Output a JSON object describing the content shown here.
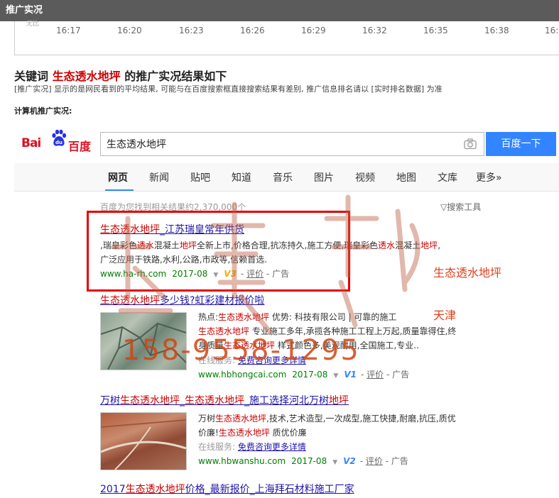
{
  "header": {
    "title": "推广实况"
  },
  "timeline": {
    "tiny_label": "无比",
    "ticks": [
      "16:17",
      "16:20",
      "16:23",
      "16:26",
      "16:29",
      "16:32",
      "16:35",
      "16:38",
      "16:4"
    ]
  },
  "summary": {
    "prefix": "关键词",
    "keyword": "生态透水地坪",
    "suffix": "的推广实况结果如下",
    "note": "[推广实况] 显示的是网民看到的平均结果, 可能与在百度搜索框直接搜索结果有差别, 推广信息排名请以 [实时排名数据] 为准",
    "pc_label": "计算机推广实况:"
  },
  "baidu": {
    "logo_bai": "Bai",
    "logo_du": "du",
    "logo_cn": "百度",
    "query": "生态透水地坪",
    "search_button": "百度一下",
    "nav": [
      "网页",
      "新闻",
      "贴吧",
      "知道",
      "音乐",
      "图片",
      "视频",
      "地图",
      "文库",
      "更多»"
    ],
    "result_count": "百度为您找到相关结果约2,370,000个",
    "tools": "▽搜索工具"
  },
  "results": [
    {
      "title_kw": "生态透水地坪",
      "title_rest": "_江苏瑞皇常年供货",
      "desc1_a": ",瑞皇彩色",
      "desc1_kw1": "透水",
      "desc1_b": "混凝土",
      "desc1_kw2": "地坪",
      "desc1_c": "全新上市,价格合理,抗冻持久,施工方便,瑞皇彩色",
      "desc1_kw3": "透水",
      "desc1_d": "混凝土",
      "desc1_kw4": "地坪",
      "desc1_e": ",",
      "desc2": "广泛应用于铁路,水利,公路,市政等,信赖首选.",
      "url": "www.ha-rh.com",
      "date": "2017-08",
      "v": "V3",
      "review": "评价",
      "ad": "广告"
    },
    {
      "title_kw": "生态透水地坪",
      "title_rest": "多少钱?虹彩建材报价啦",
      "desc1_a": "热点:",
      "desc1_kw1": "生态透水地坪",
      "desc1_b": "优势: 科技有限公司 | 可靠的施工",
      "desc2_kw": "生态透水地坪",
      "desc2": "专业施工多年,承揽各种施工工程上万起,质量靠得住,终",
      "desc3_a": "身质量",
      "desc3_kw": "生态透水地坪",
      "desc3_b": "样式颜色多,美观耐用,全国施工,专业..",
      "service": "在线服务:",
      "service_link": "免费咨询更多详情",
      "url": "www.hbhongcai.com",
      "date": "2017-08",
      "v": "V1",
      "review": "评价",
      "ad": "广告"
    },
    {
      "title_a": "万树",
      "title_kw1": "生态透水地坪",
      "title_b": "_",
      "title_kw2": "生态透水地坪",
      "title_c": "_施工选择河北万树",
      "title_kw3": "地坪",
      "desc1_a": "万树",
      "desc1_kw": "生态透水地坪",
      "desc1_b": ",技术,艺术造型,一次成型,施工快捷,耐磨,抗压,质优",
      "desc2_a": "价廉!",
      "desc2_kw": "生态透水地坪",
      "desc2_b": "质优价廉",
      "service": "在线服务:",
      "service_link": "免费咨询更多详情",
      "url": "www.hbwanshu.com",
      "date": "2017-08",
      "v": "V2",
      "review": "评价",
      "ad": "广告"
    },
    {
      "title_a": "2017",
      "title_kw": "生态透水地坪",
      "title_rest": "价格_最新报价_上海拜石材料施工厂家"
    }
  ],
  "watermark": {
    "right_text_1": "生态透水地坪",
    "right_text_2": "天津",
    "phone": "158-9558-1295"
  },
  "colors": {
    "keyword_red": "#cc0000",
    "link_blue": "#2014a8",
    "url_green": "#008000",
    "baidu_blue": "#3385ff",
    "frame_red": "#e50000"
  }
}
